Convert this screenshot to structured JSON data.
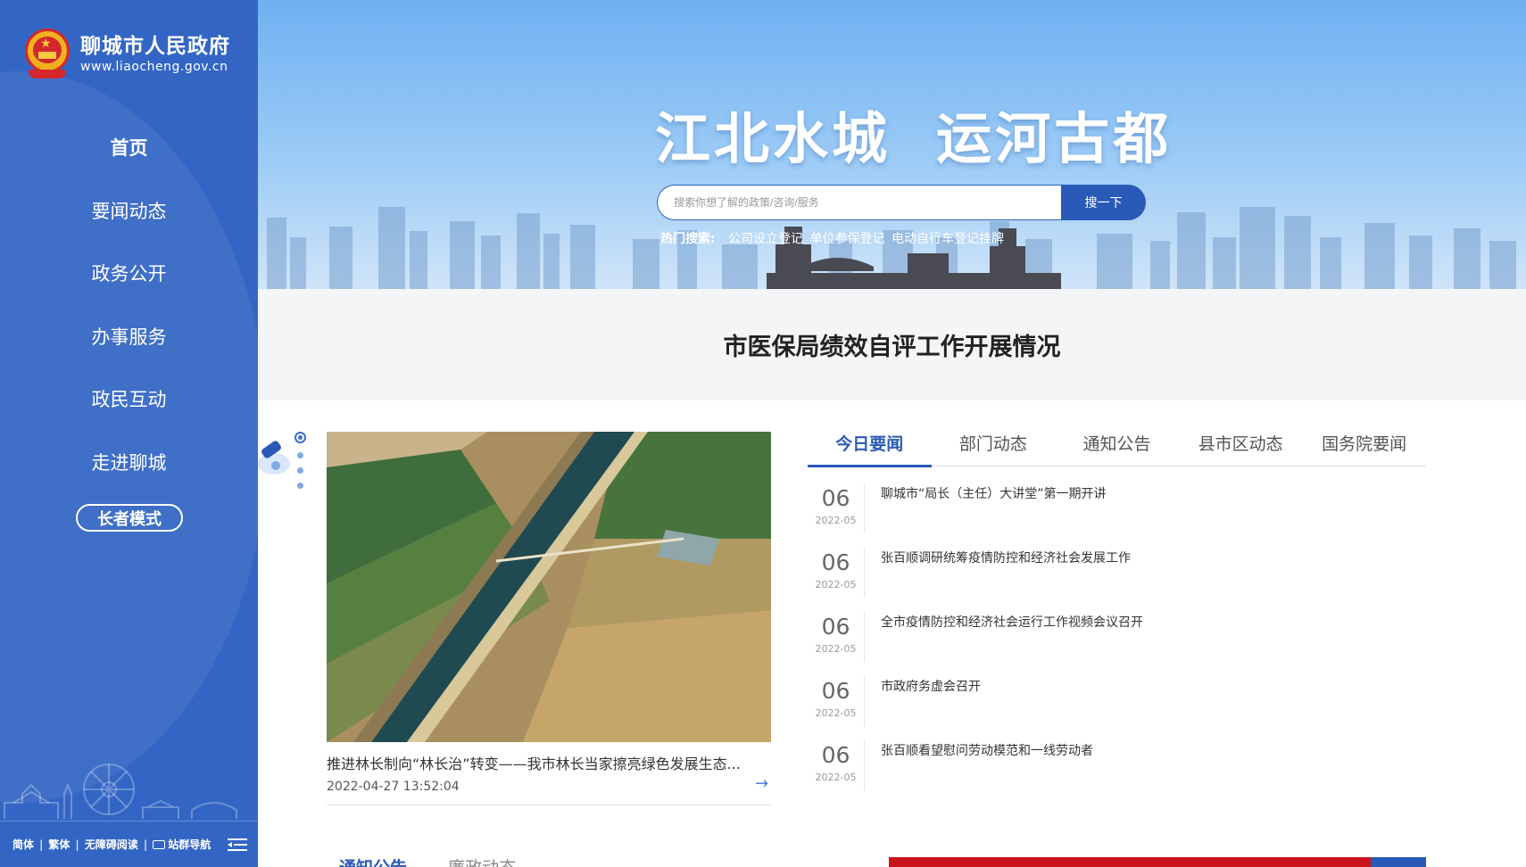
{
  "site": {
    "title": "聊城市人民政府",
    "url": "www.liaocheng.gov.cn"
  },
  "nav": {
    "items": [
      {
        "label": "首页",
        "active": true
      },
      {
        "label": "要闻动态"
      },
      {
        "label": "政务公开"
      },
      {
        "label": "办事服务"
      },
      {
        "label": "政民互动"
      },
      {
        "label": "走进聊城"
      }
    ],
    "elder_mode": "长者模式"
  },
  "footer_links": [
    "简体",
    "繁体",
    "无障碍阅读",
    "站群导航"
  ],
  "banner": {
    "slogan": "江北水城  运河古都",
    "search_placeholder": "搜索你想了解的政策/咨询/服务",
    "search_button": "搜一下",
    "hot_label": "热门搜索:",
    "hot_links": [
      "公司设立登记",
      "单位参保登记",
      "电动自行车登记挂牌"
    ]
  },
  "headline": "市医保局绩效自评工作开展情况",
  "carousel": {
    "caption": "推进林长制向“林长治”转变——我市林长当家擦亮绿色发展生态...",
    "date": "2022-04-27 13:52:04",
    "slide_count": 4,
    "active_slide": 1
  },
  "news": {
    "tabs": [
      "今日要闻",
      "部门动态",
      "通知公告",
      "县市区动态",
      "国务院要闻"
    ],
    "active_tab": 0,
    "items": [
      {
        "day": "06",
        "ym": "2022-05",
        "title": "聊城市“局长（主任）大讲堂”第一期开讲"
      },
      {
        "day": "06",
        "ym": "2022-05",
        "title": "张百顺调研统筹疫情防控和经济社会发展工作"
      },
      {
        "day": "06",
        "ym": "2022-05",
        "title": "全市疫情防控和经济社会运行工作视频会议召开"
      },
      {
        "day": "06",
        "ym": "2022-05",
        "title": "市政府务虚会召开"
      },
      {
        "day": "06",
        "ym": "2022-05",
        "title": "张百顺看望慰问劳动模范和一线劳动者"
      }
    ]
  },
  "lower": {
    "tabs": [
      "通知公告",
      "廉政动态"
    ]
  },
  "colors": {
    "sidebar": "#3366c4",
    "accent": "#2a5ab8",
    "red_bar": "#c8141b"
  }
}
